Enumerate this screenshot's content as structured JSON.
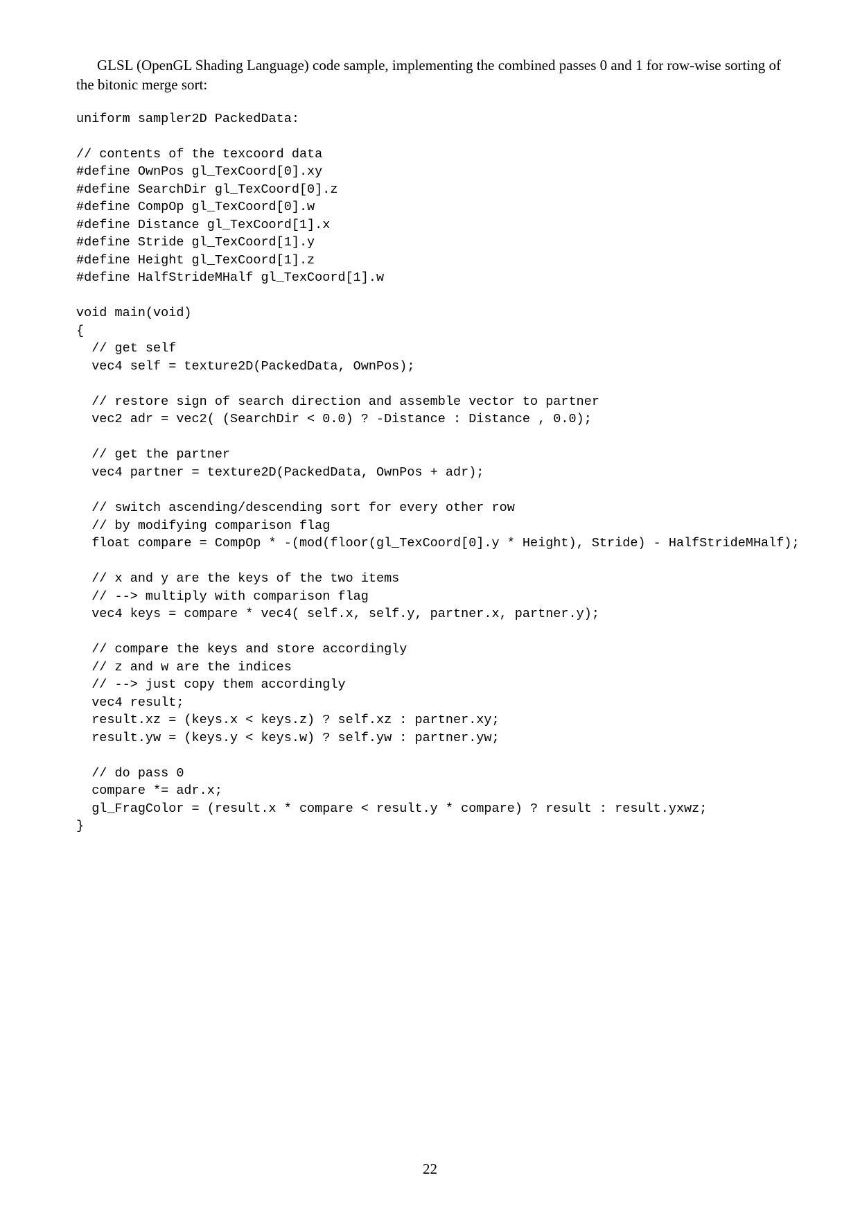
{
  "intro": "GLSL (OpenGL Shading Language) code sample, implementing the combined passes 0 and 1 for row-wise sorting of the bitonic merge sort:",
  "code": "uniform sampler2D PackedData:\n\n// contents of the texcoord data\n#define OwnPos gl_TexCoord[0].xy\n#define SearchDir gl_TexCoord[0].z\n#define CompOp gl_TexCoord[0].w\n#define Distance gl_TexCoord[1].x\n#define Stride gl_TexCoord[1].y\n#define Height gl_TexCoord[1].z\n#define HalfStrideMHalf gl_TexCoord[1].w\n\nvoid main(void)\n{\n  // get self\n  vec4 self = texture2D(PackedData, OwnPos);\n\n  // restore sign of search direction and assemble vector to partner\n  vec2 adr = vec2( (SearchDir < 0.0) ? -Distance : Distance , 0.0);\n\n  // get the partner\n  vec4 partner = texture2D(PackedData, OwnPos + adr);\n\n  // switch ascending/descending sort for every other row\n  // by modifying comparison flag\n  float compare = CompOp * -(mod(floor(gl_TexCoord[0].y * Height), Stride) - HalfStrideMHalf);\n\n  // x and y are the keys of the two items\n  // --> multiply with comparison flag\n  vec4 keys = compare * vec4( self.x, self.y, partner.x, partner.y);\n\n  // compare the keys and store accordingly\n  // z and w are the indices\n  // --> just copy them accordingly\n  vec4 result;\n  result.xz = (keys.x < keys.z) ? self.xz : partner.xy;\n  result.yw = (keys.y < keys.w) ? self.yw : partner.yw;\n\n  // do pass 0\n  compare *= adr.x;\n  gl_FragColor = (result.x * compare < result.y * compare) ? result : result.yxwz;\n}",
  "pageNumber": "22"
}
